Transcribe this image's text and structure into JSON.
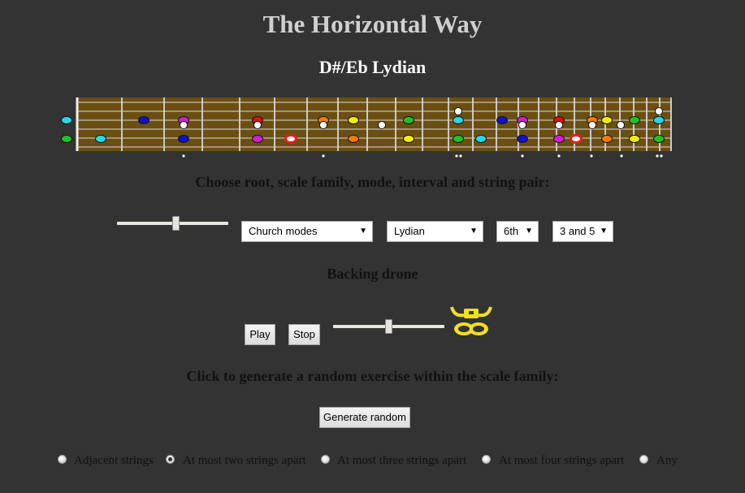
{
  "header": {
    "title": "The Horizontal Way",
    "scale_name": "D#/Eb Lydian"
  },
  "fretboard": {
    "frets": 15,
    "dot_colors": {
      "cyan": "#2ad6e6",
      "green": "#22c02a",
      "blue": "#1010d0",
      "magenta": "#d020d0",
      "red": "#e01010",
      "orange": "#f07a10",
      "yellow": "#f0ee10",
      "white": "#ffffff",
      "red_root": "#e02020"
    }
  },
  "controls": {
    "heading": "Choose root, scale family, mode, interval and string pair:",
    "root_slider_value": 0.5,
    "family_select": {
      "value": "Church modes"
    },
    "mode_select": {
      "value": "Lydian"
    },
    "interval_select": {
      "value": "6th"
    },
    "strings_select": {
      "value": "3 and 5"
    }
  },
  "drone": {
    "heading": "Backing drone",
    "play_label": "Play",
    "stop_label": "Stop",
    "volume_value": 0.5,
    "logo_color": "#f0e020"
  },
  "random": {
    "heading": "Click to generate a random exercise within the scale family:",
    "generate_label": "Generate random"
  },
  "string_distance": {
    "options": [
      {
        "label": "Adjacent strings",
        "checked": false
      },
      {
        "label": "At most two strings apart",
        "checked": true
      },
      {
        "label": "At most three strings apart",
        "checked": false
      },
      {
        "label": "At most four strings apart",
        "checked": false
      },
      {
        "label": "Any",
        "checked": false
      }
    ]
  }
}
